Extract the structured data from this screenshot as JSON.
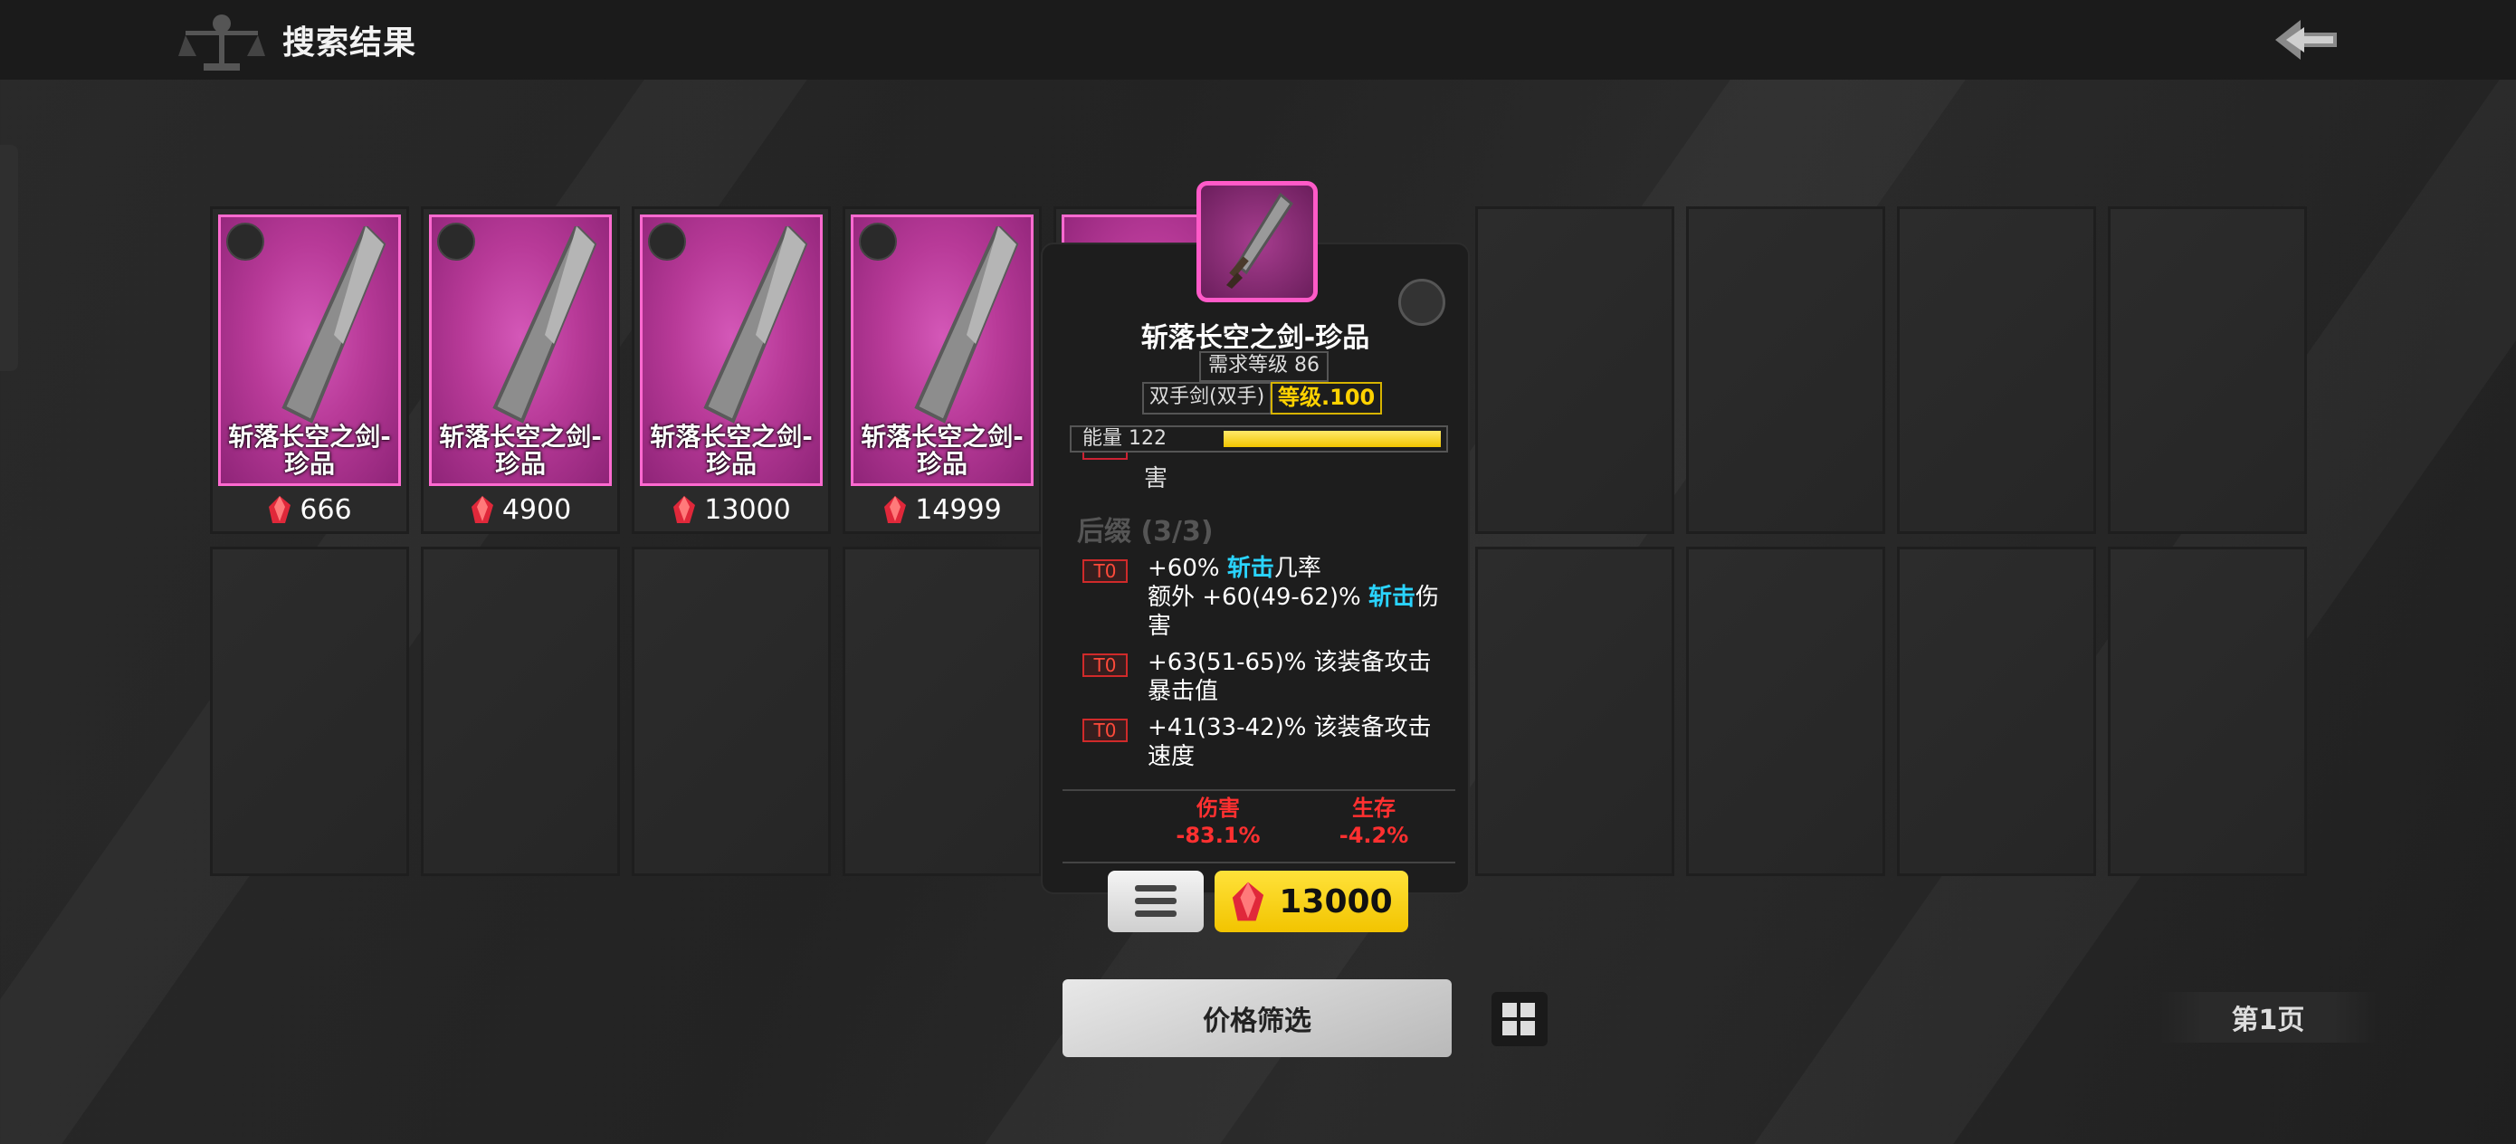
{
  "header": {
    "title": "搜索结果"
  },
  "items": [
    {
      "name": "斩落长空之剑-珍品",
      "price": "666"
    },
    {
      "name": "斩落长空之剑-珍品",
      "price": "4900"
    },
    {
      "name": "斩落长空之剑-珍品",
      "price": "13000"
    },
    {
      "name": "斩落长空之剑-珍品",
      "price": "14999"
    }
  ],
  "tooltip": {
    "name": "斩落长空之剑-珍品",
    "required_level": "需求等级 86",
    "weapon_type": "双手剑(双手)",
    "level": "等级.100",
    "energy_label": "能量 122",
    "energy_fill": 1.0,
    "cut_text": "害",
    "section_title": "后缀 (3/3)",
    "affixes": [
      {
        "tier": "T0",
        "line1_pre": "+60% ",
        "line1_hl": "斩击",
        "line1_post": "几率",
        "line2_pre": "额外 +60(49-62)% ",
        "line2_hl": "斩击",
        "line2_post": "伤",
        "line3": "害"
      },
      {
        "tier": "T0",
        "line1": "+63(51-65)% 该装备攻击",
        "line2": "暴击值"
      },
      {
        "tier": "T0",
        "line1": "+41(33-42)% 该装备攻击",
        "line2": "速度"
      }
    ],
    "stats": [
      {
        "label": "伤害",
        "value": "-83.1%"
      },
      {
        "label": "生存",
        "value": "-4.2%"
      }
    ],
    "buy_price": "13000"
  },
  "footer": {
    "filter_label": "价格筛选",
    "page_label": "第1页"
  },
  "colors": {
    "rarity_magenta": "#ff6ad0",
    "price_yellow": "#f2c400",
    "highlight_cyan": "#2ad4ff",
    "negative_red": "#ff3030"
  },
  "icons": [
    "scale-logo-icon",
    "back-arrow-icon",
    "star-badge-icon",
    "sword-icon",
    "red-crystal-icon",
    "menu-icon",
    "grid-view-icon"
  ]
}
